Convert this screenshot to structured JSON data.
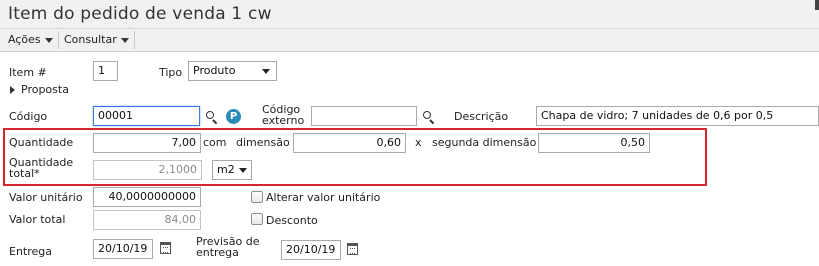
{
  "window": {
    "title": "Item do pedido de venda 1 cw"
  },
  "toolbar": {
    "acoes_label": "Ações",
    "consultar_label": "Consultar"
  },
  "item": {
    "label": "Item #",
    "value": "1"
  },
  "tipo": {
    "label": "Tipo",
    "value": "Produto"
  },
  "proposta": {
    "label": "Proposta"
  },
  "codigo": {
    "label": "Código",
    "value": "00001"
  },
  "codigo_externo": {
    "label_line1": "Código",
    "label_line2": "externo",
    "value": ""
  },
  "descricao": {
    "label": "Descrição",
    "value": "Chapa de vidro; 7 unidades de 0,6 por 0,5"
  },
  "quantidade": {
    "label": "Quantidade",
    "value": "7,00",
    "com_label": "com"
  },
  "dimensao": {
    "label": "dimensão",
    "value": "0,60",
    "x_label": "x"
  },
  "segunda_dimensao": {
    "label": "segunda dimensão",
    "value": "0,50"
  },
  "quantidade_total": {
    "label_line1": "Quantidade",
    "label_line2": "total*",
    "value": "2,1000",
    "unit": "m2"
  },
  "valor_unitario": {
    "label": "Valor unitário",
    "value": "40,0000000000"
  },
  "alterar_valor_unitario": {
    "label": "Alterar valor unitário",
    "checked": false
  },
  "valor_total": {
    "label": "Valor total",
    "value": "84,00"
  },
  "desconto": {
    "label": "Desconto",
    "checked": false
  },
  "entrega": {
    "label": "Entrega",
    "value": "20/10/19"
  },
  "previsao_entrega": {
    "label_line1": "Previsão de",
    "label_line2": "entrega",
    "value": "20/10/19"
  },
  "icons": {
    "codigo_search": "search-icon",
    "codigo_info": "info-icon",
    "codigo_externo_search": "search-icon",
    "entrega_calendar": "calendar-icon",
    "previsao_calendar": "calendar-icon"
  },
  "colors": {
    "highlight": "#d8262f",
    "focus": "#3b7dd8",
    "info": "#2a8bb6"
  }
}
